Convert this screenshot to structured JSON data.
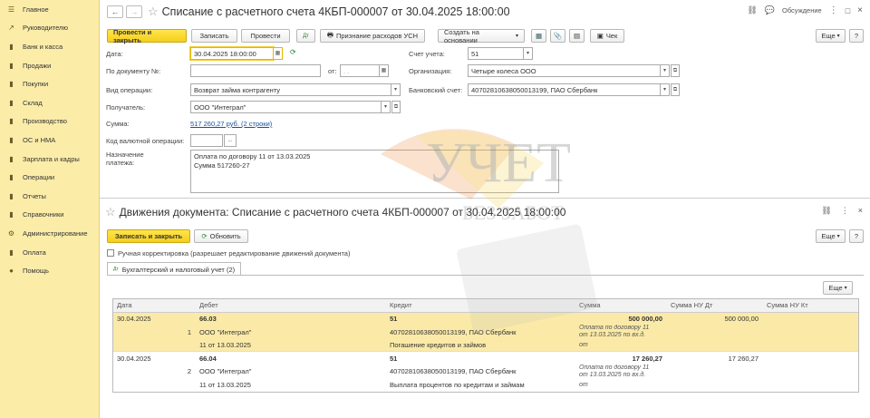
{
  "sidebar": {
    "items": [
      {
        "label": "Главное",
        "icon": "menu-icon"
      },
      {
        "label": "Руководителю",
        "icon": "chart-icon"
      },
      {
        "label": "Банк и касса",
        "icon": "bank-icon"
      },
      {
        "label": "Продажи",
        "icon": "cart-icon"
      },
      {
        "label": "Покупки",
        "icon": "basket-icon"
      },
      {
        "label": "Склад",
        "icon": "warehouse-icon"
      },
      {
        "label": "Производство",
        "icon": "factory-icon"
      },
      {
        "label": "ОС и НМА",
        "icon": "assets-icon"
      },
      {
        "label": "Зарплата и кадры",
        "icon": "people-icon"
      },
      {
        "label": "Операции",
        "icon": "operations-icon"
      },
      {
        "label": "Отчеты",
        "icon": "reports-icon"
      },
      {
        "label": "Справочники",
        "icon": "book-icon"
      },
      {
        "label": "Администрирование",
        "icon": "gear-icon"
      },
      {
        "label": "Оплата",
        "icon": "payment-icon"
      },
      {
        "label": "Помощь",
        "icon": "help-icon"
      }
    ]
  },
  "doc": {
    "title": "Списание с расчетного счета 4КБП-000007 от 30.04.2025 18:00:00",
    "discussion": "Обсуждение",
    "toolbar": {
      "post_close": "Провести и закрыть",
      "save": "Записать",
      "post": "Провести",
      "usn": "Признание расходов УСН",
      "create_based": "Создать на основании",
      "check": "Чек",
      "more": "Еще",
      "help": "?"
    },
    "fields": {
      "date_label": "Дата:",
      "date_value": "30.04.2025 18:00:00",
      "by_doc_label": "По документу №:",
      "from_label": "от:",
      "from_value": ". .",
      "op_type_label": "Вид операции:",
      "op_type_value": "Возврат займа контрагенту",
      "recipient_label": "Получатель:",
      "recipient_value": "ООО \"Интеграл\"",
      "sum_label": "Сумма:",
      "sum_value": "517 260,27 руб. (2 строки)",
      "currency_op_label": "Код валютной операции:",
      "currency_op_value": "...",
      "purpose_label": "Назначение платежа:",
      "purpose_line1": "Оплата по договору 11 от 13.03.2025",
      "purpose_line2": "Сумма 517260-27",
      "account_label": "Счет учета:",
      "account_value": "51",
      "org_label": "Организация:",
      "org_value": "Четыре колеса ООО",
      "bank_label": "Банковский счет:",
      "bank_value": "40702810638050013199, ПАО Сбербанк"
    }
  },
  "movements": {
    "title": "Движения документа: Списание с расчетного счета 4КБП-000007 от 30.04.2025 18:00:00",
    "save_close": "Записать и закрыть",
    "refresh": "Обновить",
    "more": "Еще",
    "help": "?",
    "manual_label": "Ручная корректировка (разрешает редактирование движений документа)",
    "tab": "Бухгалтерский и налоговый учет (2)",
    "table_more": "Еще",
    "columns": [
      "Дата",
      "Дебет",
      "Кредит",
      "Сумма",
      "Сумма НУ Дт",
      "Сумма НУ Кт"
    ],
    "rows": [
      {
        "date": "30.04.2025",
        "num": "1",
        "debit": [
          "66.03",
          "ООО \"Интеграл\"",
          "11 от 13.03.2025"
        ],
        "credit": [
          "51",
          "40702810638050013199, ПАО Сбербанк",
          "Погашение кредитов и займов"
        ],
        "sum": "500 000,00",
        "content": [
          "Оплата по договору 11",
          "от 13.03.2025 по вх.д.",
          "от"
        ],
        "nu_dt": "500 000,00",
        "nu_kt": ""
      },
      {
        "date": "30.04.2025",
        "num": "2",
        "debit": [
          "66.04",
          "ООО \"Интеграл\"",
          "11 от 13.03.2025"
        ],
        "credit": [
          "51",
          "40702810638050013199, ПАО Сбербанк",
          "Выплата процентов по кредитам и займам"
        ],
        "sum": "17 260,27",
        "content": [
          "Оплата по договору 11",
          "от 13.03.2025 по вх.д.",
          "от"
        ],
        "nu_dt": "17 260,27",
        "nu_kt": ""
      }
    ]
  },
  "watermark": {
    "line1": "УЧЕТ",
    "line2": "БЕЗ ЗАБОТ"
  },
  "colors": {
    "sidebar": "#fbeca8",
    "accent": "#f5cf1a",
    "highlight": "#fbeaa7",
    "link": "#1a4f9a"
  }
}
